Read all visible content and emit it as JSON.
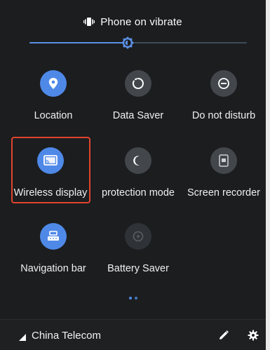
{
  "volume": {
    "label": "Phone on vibrate",
    "level": 0.45
  },
  "tiles": [
    {
      "id": "location",
      "label": "Location",
      "state": "on",
      "icon": "location-pin-icon"
    },
    {
      "id": "data-saver",
      "label": "Data Saver",
      "state": "off",
      "icon": "data-saver-icon"
    },
    {
      "id": "do-not-disturb",
      "label": "Do not disturb",
      "state": "off",
      "icon": "do-not-disturb-icon"
    },
    {
      "id": "wireless-display",
      "label": "Wireless display",
      "state": "on",
      "icon": "cast-icon"
    },
    {
      "id": "eye-protection",
      "label": "Eye protection mode",
      "state": "off",
      "icon": "moon-icon"
    },
    {
      "id": "screen-recorder",
      "label": "Screen recorder",
      "state": "off",
      "icon": "screen-recorder-icon"
    },
    {
      "id": "navigation-bar",
      "label": "Navigation bar",
      "state": "on",
      "icon": "navigation-bar-icon"
    },
    {
      "id": "battery-saver",
      "label": "Battery Saver",
      "state": "disabled",
      "icon": "battery-saver-icon"
    }
  ],
  "pager": {
    "pages": 2,
    "current": 1
  },
  "bottom": {
    "carrier": "China Telecom"
  },
  "colors": {
    "accent": "#4f89e8",
    "highlight": "#e0442f",
    "background": "#1b1d1f"
  }
}
